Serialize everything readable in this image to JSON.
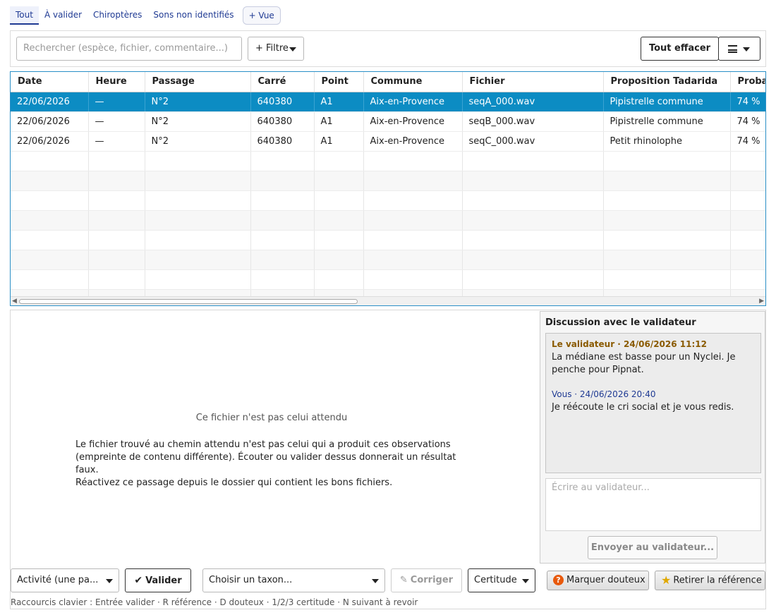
{
  "tabs": [
    "Tout",
    "À valider",
    "Chiroptères",
    "Sons non identifiés"
  ],
  "add_view": "+ Vue",
  "search": {
    "placeholder": "Rechercher (espèce, fichier, commentaire...)"
  },
  "filter_label": "+ Filtre",
  "clear_label": "Tout effacer",
  "columns": [
    "Date",
    "Heure",
    "Passage",
    "Carré",
    "Point",
    "Commune",
    "Fichier",
    "Proposition Tadarida",
    "Proba"
  ],
  "rows": [
    [
      "22/06/2026",
      "—",
      "N°2",
      "640380",
      "A1",
      "Aix-en-Provence",
      "seqA_000.wav",
      "Pipistrelle commune",
      "74 %"
    ],
    [
      "22/06/2026",
      "—",
      "N°2",
      "640380",
      "A1",
      "Aix-en-Provence",
      "seqB_000.wav",
      "Pipistrelle commune",
      "74 %"
    ],
    [
      "22/06/2026",
      "—",
      "N°2",
      "640380",
      "A1",
      "Aix-en-Provence",
      "seqC_000.wav",
      "Petit rhinolophe",
      "74 %"
    ]
  ],
  "detail": {
    "title": "Ce fichier n'est pas celui attendu",
    "line1": "Le fichier trouvé au chemin attendu n'est pas celui qui a produit ces observations",
    "line2": "(empreinte de contenu différente). Écouter ou valider dessus donnerait un résultat faux.",
    "line3": "Réactivez ce passage depuis le dossier qui contient les bons fichiers."
  },
  "chat": {
    "title": "Discussion avec le validateur",
    "messages": [
      {
        "head": "Le validateur · 24/06/2026 11:12",
        "text": "La médiane est basse pour un Nyclei. Je penche pour Pipnat."
      },
      {
        "head": "Vous · 24/06/2026 20:40",
        "text": "Je réécoute le cri social et je vous redis."
      }
    ],
    "placeholder": "Écrire au validateur...",
    "send": "Envoyer au validateur..."
  },
  "actions": {
    "activity": "Activité (une pa...",
    "validate": "Valider",
    "taxon": "Choisir un taxon...",
    "correct": "Corriger",
    "certainty": "Certitude",
    "doubt": "Marquer douteux",
    "ref": "Retirer la référence"
  },
  "hint": "Raccourcis clavier : Entrée valider · R référence · D douteux · 1/2/3 certitude · N suivant à revoir"
}
